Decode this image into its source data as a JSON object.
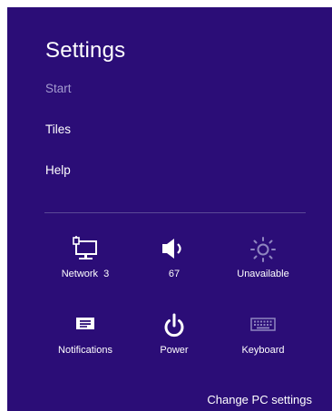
{
  "charm": {
    "title": "Settings",
    "menu": [
      {
        "label": "Start",
        "state": "dimmed"
      },
      {
        "label": "Tiles"
      },
      {
        "label": "Help"
      }
    ],
    "quick_settings": [
      {
        "label": "Network  3",
        "icon": "network-icon"
      },
      {
        "label": "67",
        "icon": "volume-icon"
      },
      {
        "label": "Unavailable",
        "icon": "brightness-icon"
      },
      {
        "label": "Notifications",
        "icon": "notifications-icon"
      },
      {
        "label": "Power",
        "icon": "power-icon"
      },
      {
        "label": "Keyboard",
        "icon": "keyboard-icon"
      }
    ],
    "change_pc_settings": "Change PC settings"
  },
  "colors": {
    "background": "#2b0d77",
    "text": "#ffffff",
    "muted_text": "#a49bd0",
    "divider": "#5a4896",
    "disabled_icon": "#8f86c0"
  }
}
